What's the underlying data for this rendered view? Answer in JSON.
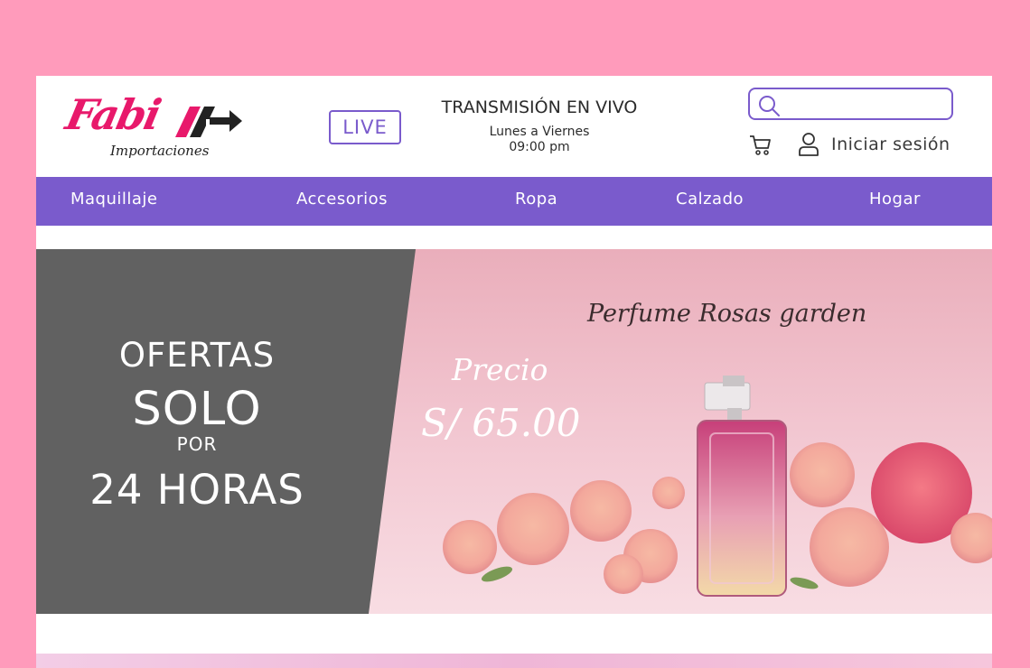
{
  "brand": {
    "logo_text": "Fabi",
    "logo_subtext": "Importaciones"
  },
  "header": {
    "live_badge": "LIVE",
    "stream_title": "TRANSMISIÓN EN VIVO",
    "stream_days": "Lunes a Viernes",
    "stream_time": "09:00 pm",
    "search_placeholder": "",
    "login_label": "Iniciar sesión"
  },
  "nav": {
    "items": [
      "Maquillaje",
      "Accesorios",
      "Ropa",
      "Calzado",
      "Hogar"
    ]
  },
  "banner": {
    "offer_line1": "OFERTAS",
    "offer_line2": "SOLO",
    "offer_line3": "POR",
    "offer_line4": "24 HORAS",
    "product_name": "Perfume Rosas garden",
    "price_label": "Precio",
    "price_value": "S/ 65.00"
  },
  "colors": {
    "page_background": "#ff9bbb",
    "accent": "#7a5bcc",
    "brand_pink": "#e8196b",
    "offer_panel": "#616161"
  },
  "icons": [
    "search-icon",
    "cart-icon",
    "user-icon"
  ]
}
